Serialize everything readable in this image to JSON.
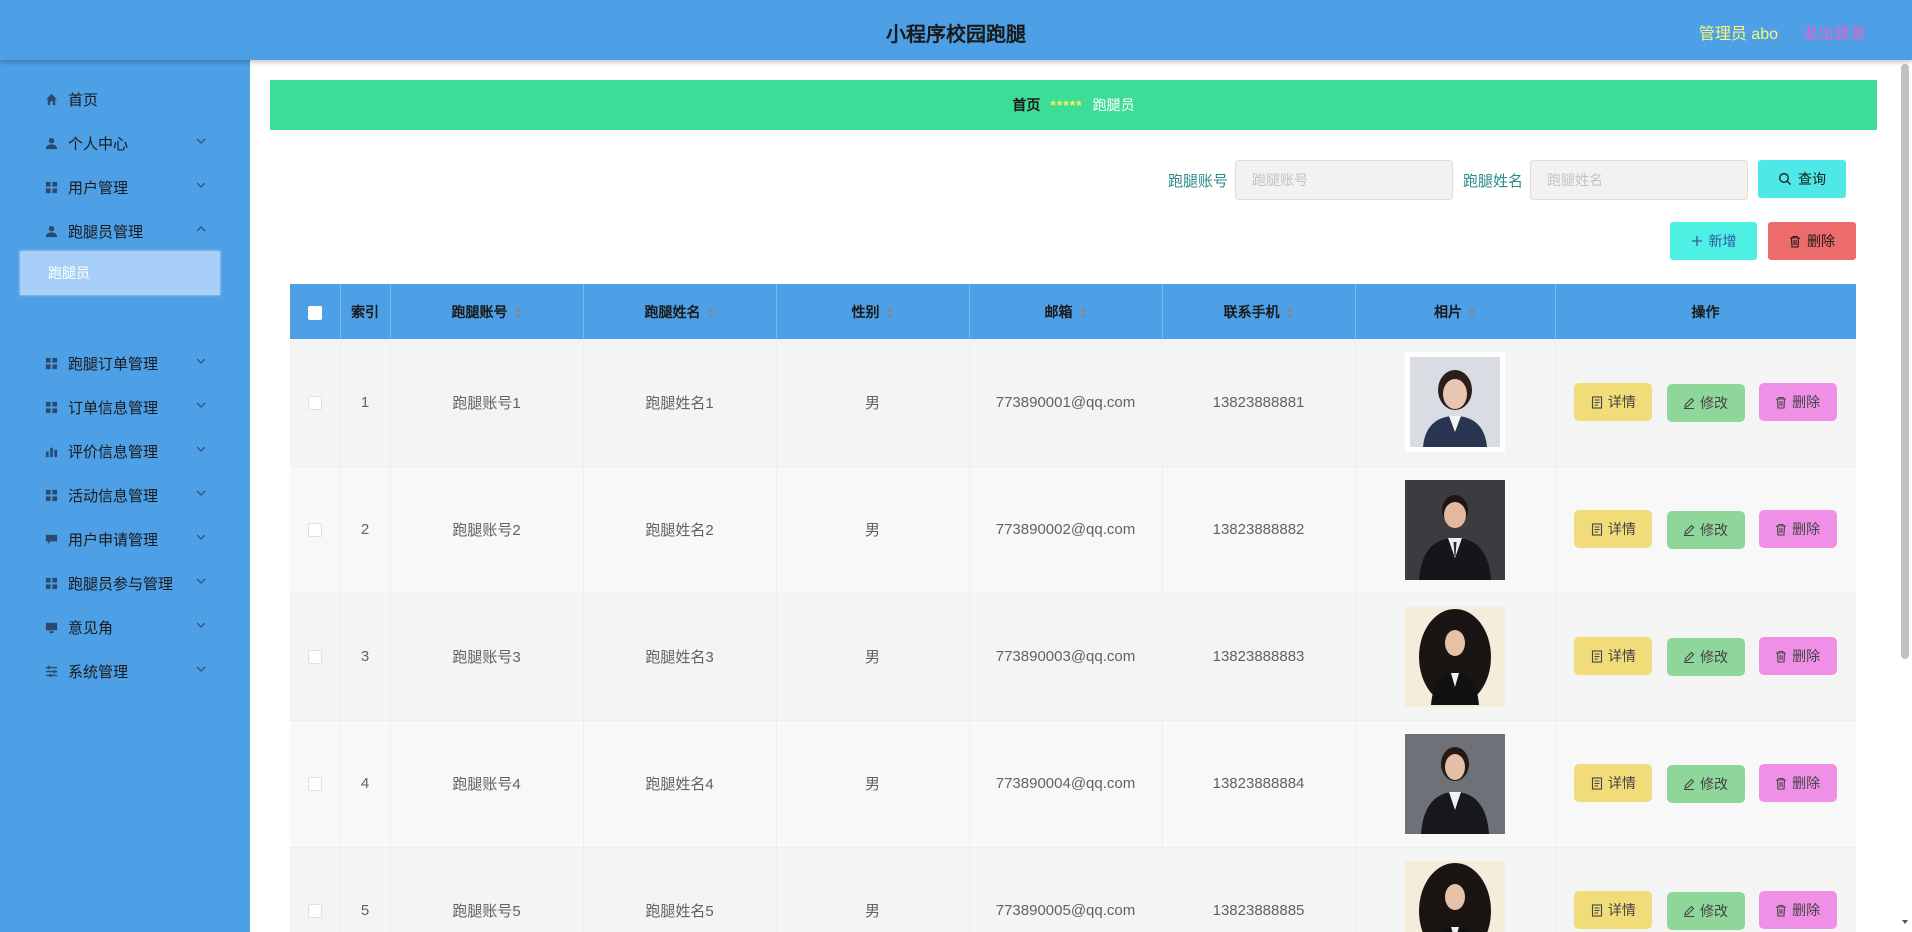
{
  "header": {
    "title": "小程序校园跑腿",
    "admin": "管理员 abo",
    "logout": "退出登录"
  },
  "sidebar": {
    "items": [
      {
        "label": "首页",
        "icon": "home-icon",
        "has_children": false
      },
      {
        "label": "个人中心",
        "icon": "user-icon",
        "has_children": true
      },
      {
        "label": "用户管理",
        "icon": "grid-icon",
        "has_children": true
      },
      {
        "label": "跑腿员管理",
        "icon": "user-icon",
        "has_children": true
      },
      {
        "label": "跑腿订单管理",
        "icon": "grid-icon",
        "has_children": true
      },
      {
        "label": "订单信息管理",
        "icon": "grid-icon",
        "has_children": true
      },
      {
        "label": "评价信息管理",
        "icon": "bar-chart-icon",
        "has_children": true
      },
      {
        "label": "活动信息管理",
        "icon": "grid-icon",
        "has_children": true
      },
      {
        "label": "用户申请管理",
        "icon": "comment-icon",
        "has_children": true
      },
      {
        "label": "跑腿员参与管理",
        "icon": "grid-icon",
        "has_children": true
      },
      {
        "label": "意见角",
        "icon": "monitor-icon",
        "has_children": true
      },
      {
        "label": "系统管理",
        "icon": "sliders-icon",
        "has_children": true
      }
    ],
    "active_sub": "跑腿员"
  },
  "breadcrumb": {
    "home": "首页",
    "separator": "*****",
    "current": "跑腿员"
  },
  "search": {
    "account_label": "跑腿账号",
    "account_placeholder": "跑腿账号",
    "name_label": "跑腿姓名",
    "name_placeholder": "跑腿姓名",
    "query_button": "查询"
  },
  "actions": {
    "add": "新增",
    "delete": "删除"
  },
  "table": {
    "columns": [
      "索引",
      "跑腿账号",
      "跑腿姓名",
      "性别",
      "邮箱",
      "联系手机",
      "相片",
      "操作"
    ],
    "row_buttons": {
      "detail": "详情",
      "edit": "修改",
      "delete": "删除"
    },
    "rows": [
      {
        "index": "1",
        "account": "跑腿账号1",
        "name": "跑腿姓名1",
        "gender": "男",
        "email": "773890001@qq.com",
        "phone": "13823888881"
      },
      {
        "index": "2",
        "account": "跑腿账号2",
        "name": "跑腿姓名2",
        "gender": "男",
        "email": "773890002@qq.com",
        "phone": "13823888882"
      },
      {
        "index": "3",
        "account": "跑腿账号3",
        "name": "跑腿姓名3",
        "gender": "男",
        "email": "773890003@qq.com",
        "phone": "13823888883"
      },
      {
        "index": "4",
        "account": "跑腿账号4",
        "name": "跑腿姓名4",
        "gender": "男",
        "email": "773890004@qq.com",
        "phone": "13823888884"
      },
      {
        "index": "5",
        "account": "跑腿账号5",
        "name": "跑腿姓名5",
        "gender": "男",
        "email": "773890005@qq.com",
        "phone": "13823888885"
      }
    ]
  },
  "colors": {
    "primary": "#4d9fe6",
    "breadcrumb_bg": "#3ddc97",
    "query_btn": "#4fe8e8",
    "add_btn": "#4ff0e4",
    "delete_btn": "#ee6b6b",
    "detail_btn": "#f0dc78",
    "edit_btn": "#8fd69a",
    "row_delete_btn": "#ef8fe6"
  }
}
